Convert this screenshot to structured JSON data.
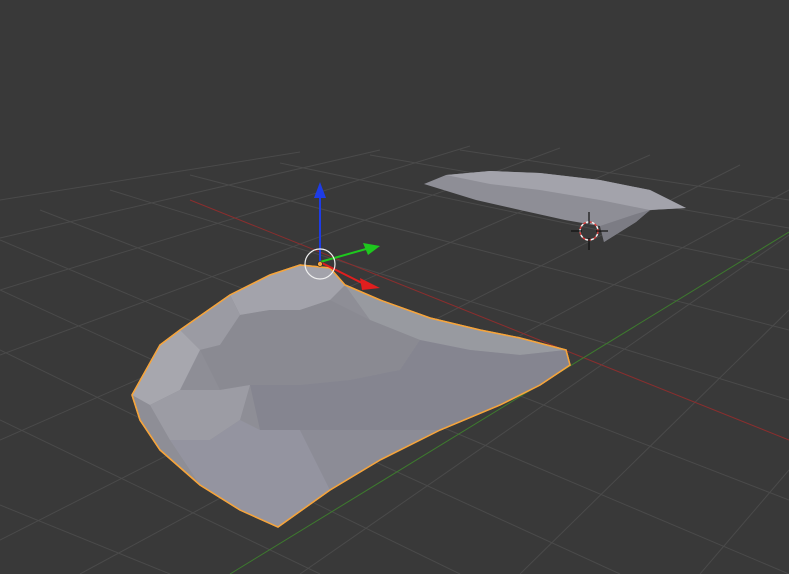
{
  "viewport": {
    "name": "3d-viewport",
    "background": "#393939"
  },
  "colors": {
    "grid": "#4a4a4a",
    "x_axis": "#8a2e2e",
    "y_axis": "#3d7a2e",
    "mesh_fill": "#8e8e96",
    "mesh_light": "#a3a3ab",
    "mesh_dark": "#7c7c84",
    "selection_outline": "#f5a43c",
    "gizmo_x": "#e01e1e",
    "gizmo_y": "#1ec81e",
    "gizmo_z": "#1e3ce6",
    "origin": "#f5a43c",
    "cursor_red": "#d94040",
    "cursor_white": "#f0f0f0"
  },
  "objects": [
    {
      "name": "selected-mesh-object",
      "selected": true
    },
    {
      "name": "unselected-mesh-object",
      "selected": false
    }
  ],
  "tools": {
    "transform_gizmo": "translate",
    "cursor": "3d-cursor"
  }
}
